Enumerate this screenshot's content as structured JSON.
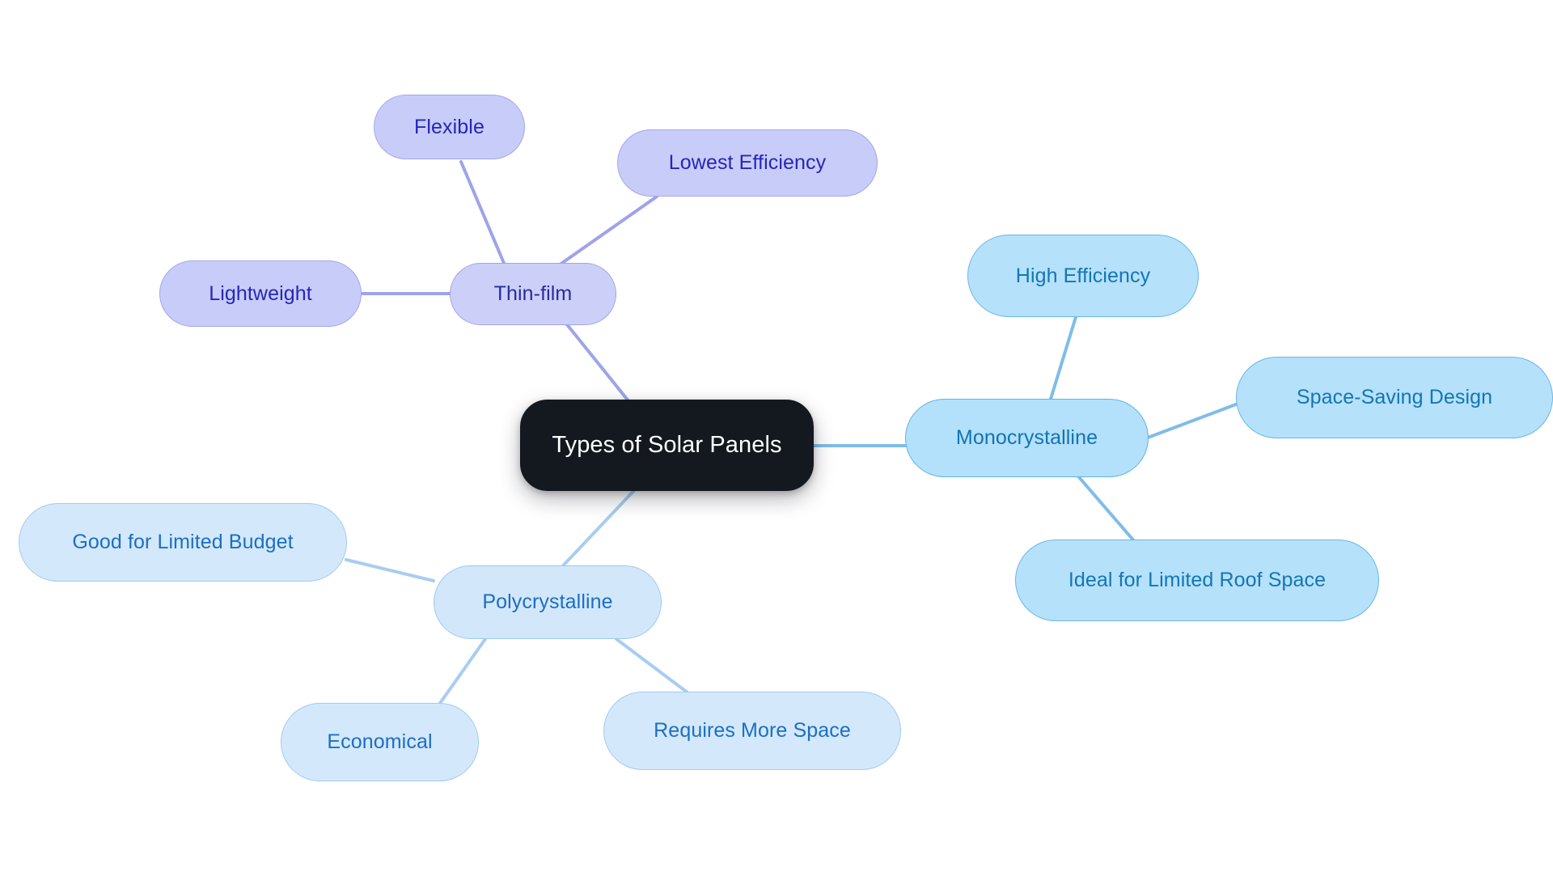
{
  "diagram": {
    "type": "mindmap",
    "title": "Types of Solar Panels",
    "background_color": "#ffffff",
    "root": {
      "label": "Types of Solar Panels",
      "fill": "#14181f",
      "text_color": "#ffffff"
    },
    "branches": [
      {
        "id": "thin-film",
        "label": "Thin-film",
        "fill": "#ccd0f8",
        "border": "#9fa3e8",
        "text_color": "#2a2a9c",
        "connector_color": "#9fa3e8",
        "children": [
          {
            "id": "flexible",
            "label": "Flexible"
          },
          {
            "id": "lowest-efficiency",
            "label": "Lowest Efficiency"
          },
          {
            "id": "lightweight",
            "label": "Lightweight"
          }
        ]
      },
      {
        "id": "monocrystalline",
        "label": "Monocrystalline",
        "fill": "#b3e0fb",
        "border": "#63b3e4",
        "text_color": "#1274b0",
        "connector_color": "#7fbde8",
        "children": [
          {
            "id": "high-efficiency",
            "label": "High Efficiency"
          },
          {
            "id": "space-saving-design",
            "label": "Space-Saving Design"
          },
          {
            "id": "ideal-for-limited-roof-space",
            "label": "Ideal for Limited Roof Space"
          }
        ]
      },
      {
        "id": "polycrystalline",
        "label": "Polycrystalline",
        "fill": "#d3e7fb",
        "border": "#9ec8f0",
        "text_color": "#1a6fc4",
        "connector_color": "#a8cdf0",
        "children": [
          {
            "id": "good-for-limited-budget",
            "label": "Good for Limited Budget"
          },
          {
            "id": "economical",
            "label": "Economical"
          },
          {
            "id": "requires-more-space",
            "label": "Requires More Space"
          }
        ]
      }
    ]
  },
  "nodes": {
    "root": "Types of Solar Panels",
    "thin_film": "Thin-film",
    "flexible": "Flexible",
    "lowest_efficiency": "Lowest Efficiency",
    "lightweight": "Lightweight",
    "monocrystalline": "Monocrystalline",
    "high_efficiency": "High Efficiency",
    "space_saving_design": "Space-Saving Design",
    "ideal_for_limited_roof_space": "Ideal for Limited Roof Space",
    "polycrystalline": "Polycrystalline",
    "good_for_limited_budget": "Good for Limited Budget",
    "economical": "Economical",
    "requires_more_space": "Requires More Space"
  }
}
